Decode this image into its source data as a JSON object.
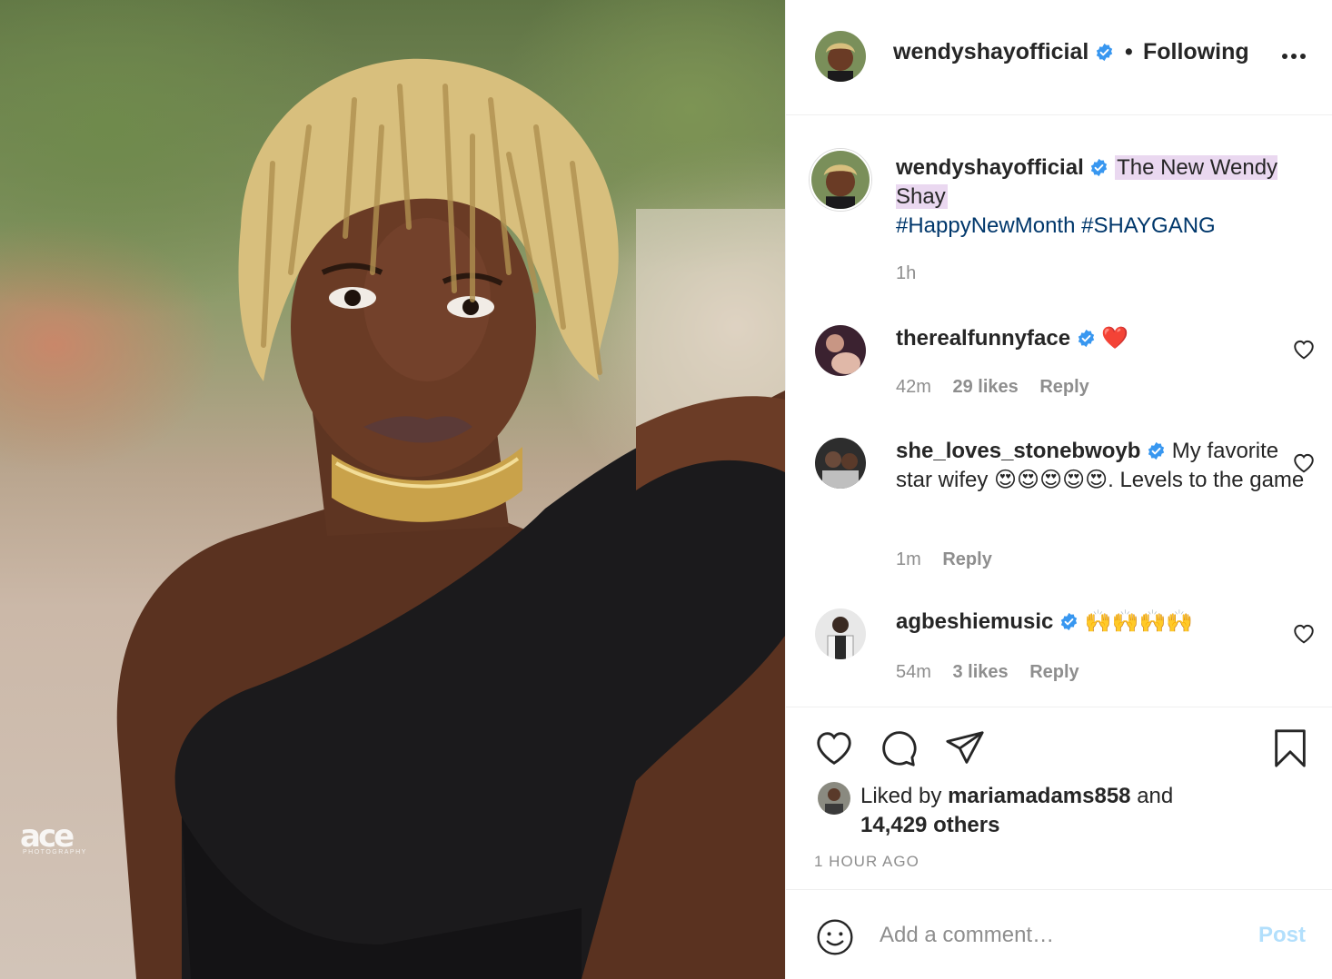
{
  "colors": {
    "link_blue": "#00376b",
    "verified_blue": "#3897f0",
    "muted_text": "#8e8e8e",
    "post_button_disabled": "#b2dffc",
    "caption_highlight": "#ead8f0",
    "heart_red": "#ed4956"
  },
  "photo": {
    "watermark": "ace",
    "watermark_sub": "PHOTOGRAPHY"
  },
  "header": {
    "username": "wendyshayofficial",
    "verified": true,
    "separator": "•",
    "follow_status": "Following",
    "more_icon": "more-options-icon"
  },
  "caption": {
    "username": "wendyshayofficial",
    "text_highlighted": "The New Wendy Shay",
    "hashtags": [
      "#HappyNewMonth",
      "#SHAYGANG"
    ],
    "time": "1h"
  },
  "comments": [
    {
      "username": "therealfunnyface",
      "text": "❤️",
      "time": "42m",
      "likes": "29 likes",
      "reply": "Reply"
    },
    {
      "username": "she_loves_stonebwoyb",
      "text": "My favorite star wifey 😍😍😍😍😍. Levels to the game",
      "time": "1m",
      "likes": "",
      "reply": "Reply"
    },
    {
      "username": "agbeshiemusic",
      "text": "🙌🙌🙌🙌",
      "time": "54m",
      "likes": "3 likes",
      "reply": "Reply"
    }
  ],
  "likes": {
    "prefix": "Liked by",
    "user": "mariamadams858",
    "connector": "and",
    "others": "14,429 others"
  },
  "timestamp": "1 HOUR AGO",
  "add_comment": {
    "placeholder": "Add a comment…",
    "post_label": "Post"
  }
}
